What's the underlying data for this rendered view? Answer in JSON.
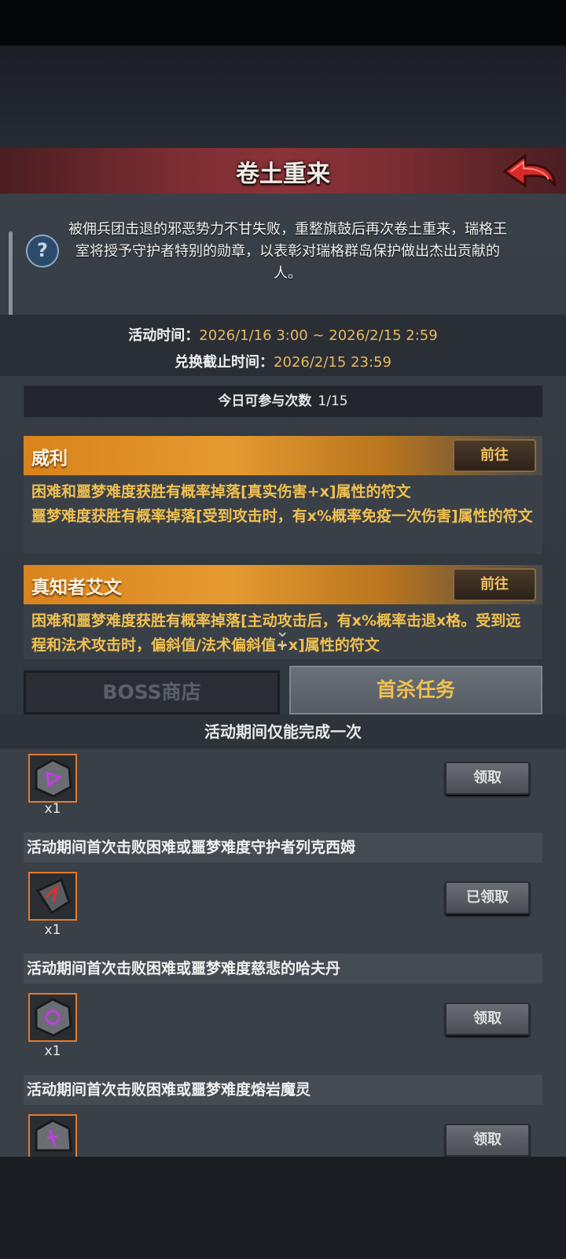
{
  "header": {
    "title": "卷土重来"
  },
  "intro": {
    "description": "被佣兵团击退的邪恶势力不甘失败，重整旗鼓后再次卷土重来，瑞格王室将授予守护者特别的勋章，以表彰对瑞格群岛保护做出杰出贡献的人。"
  },
  "times": {
    "event_label": "活动时间：",
    "event_value": "2026/1/16 3:00 ~ 2026/2/15 2:59",
    "exchange_label": "兑换截止时间：",
    "exchange_value": "2026/2/15 23:59"
  },
  "participation": {
    "label": "今日可参与次数",
    "value": "1/15"
  },
  "bosses": [
    {
      "name": "威利",
      "button": "前往",
      "lines": [
        "困难和噩梦难度获胜有概率掉落[真实伤害+x]属性的符文",
        "噩梦难度获胜有概率掉落[受到攻击时，有x%概率免疫一次伤害]属性的符文"
      ]
    },
    {
      "name": "真知者艾文",
      "button": "前往",
      "lines": [
        "困难和噩梦难度获胜有概率掉落[主动攻击后，有x%概率击退x格。受到远程和法术攻击时，偏斜值/法术偏斜值+x]属性的符文"
      ]
    }
  ],
  "tabs": {
    "boss_shop": "BOSS商店",
    "first_kill": "首杀任务"
  },
  "quests": {
    "header": "活动期间仅能完成一次",
    "items": [
      {
        "title": "",
        "count": "x1",
        "button": "领取"
      },
      {
        "title": "活动期间首次击败困难或噩梦难度守护者列克西姆",
        "count": "x1",
        "button": "已领取"
      },
      {
        "title": "活动期间首次击败困难或噩梦难度慈悲的哈夫丹",
        "count": "x1",
        "button": "领取"
      },
      {
        "title": "活动期间首次击败困难或噩梦难度熔岩魔灵",
        "count": "",
        "button": "领取"
      }
    ]
  },
  "icons": {
    "help": "?",
    "chevron": "⌄"
  },
  "colors": {
    "accent_orange": "#e59a30",
    "highlight_gold": "#f0c050",
    "title_red": "#7a2d32"
  }
}
